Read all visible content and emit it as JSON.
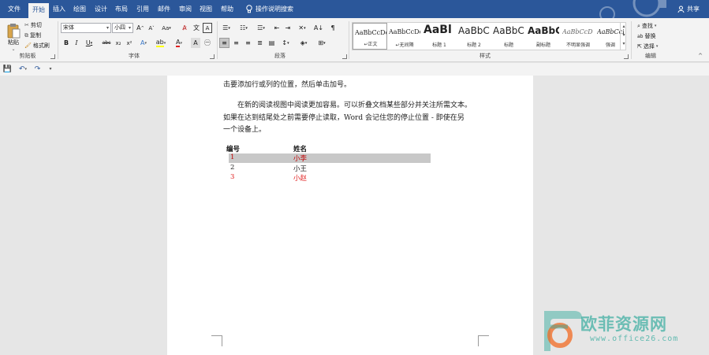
{
  "menu": {
    "tabs": [
      "文件",
      "开始",
      "插入",
      "绘图",
      "设计",
      "布局",
      "引用",
      "邮件",
      "审阅",
      "视图",
      "帮助"
    ],
    "active_tab": "开始",
    "tell_me": "操作说明搜索",
    "share": "共享"
  },
  "clipboard": {
    "paste": "粘贴",
    "cut": "剪切",
    "copy": "复制",
    "format_painter": "格式刷",
    "label": "剪贴板"
  },
  "font": {
    "name": "宋体",
    "size": "小四",
    "bold": "B",
    "italic": "I",
    "underline": "U",
    "strike": "abc",
    "subscript": "x₂",
    "superscript": "x²",
    "grow": "A",
    "shrink": "A",
    "change_case": "Aa",
    "label": "字体"
  },
  "paragraph": {
    "label": "段落"
  },
  "styles": {
    "items": [
      {
        "preview": "AaBbCcDc",
        "name": "正文"
      },
      {
        "preview": "AaBbCcDc",
        "name": "无间隔"
      },
      {
        "preview": "AaBl",
        "name": "标题 1"
      },
      {
        "preview": "AaBbC",
        "name": "标题 2"
      },
      {
        "preview": "AaBbC",
        "name": "标题"
      },
      {
        "preview": "AaBbC",
        "name": "副标题"
      },
      {
        "preview": "AaBbCcD",
        "name": "不明显强调"
      },
      {
        "preview": "AaBbCcD",
        "name": "强调"
      }
    ],
    "label": "样式"
  },
  "editing": {
    "find": "查找",
    "replace": "替换",
    "select": "选择",
    "label": "编辑"
  },
  "document": {
    "line1": "击要添加行或列的位置，然后单击加号。",
    "para2_line1": "在新的阅读视图中阅读更加容易。可以折叠文档某些部分并关注所需文本。",
    "para2_line2": "如果在达到结尾处之前需要停止读取，Word 会记住您的停止位置 - 即使在另",
    "para2_line3": "一个设备上。",
    "table": {
      "headers": [
        "编号",
        "姓名"
      ],
      "rows": [
        {
          "id": "1",
          "name": "小李",
          "highlight": true,
          "color": "#c00000"
        },
        {
          "id": "2",
          "name": "小王",
          "highlight": false,
          "color": "#222222"
        },
        {
          "id": "3",
          "name": "小赵",
          "highlight": false,
          "color": "#e02020"
        }
      ]
    }
  },
  "watermark": {
    "title": "欧菲资源网",
    "url": "www.office26.com"
  },
  "colors": {
    "accent": "#2b579a",
    "ribbon": "#f3f3f3",
    "canvas": "#e6e6e6",
    "highlight_row": "#c8c8c8",
    "red": "#c00000",
    "watermark_orange": "#f26a21",
    "watermark_teal": "#2aa89a"
  }
}
